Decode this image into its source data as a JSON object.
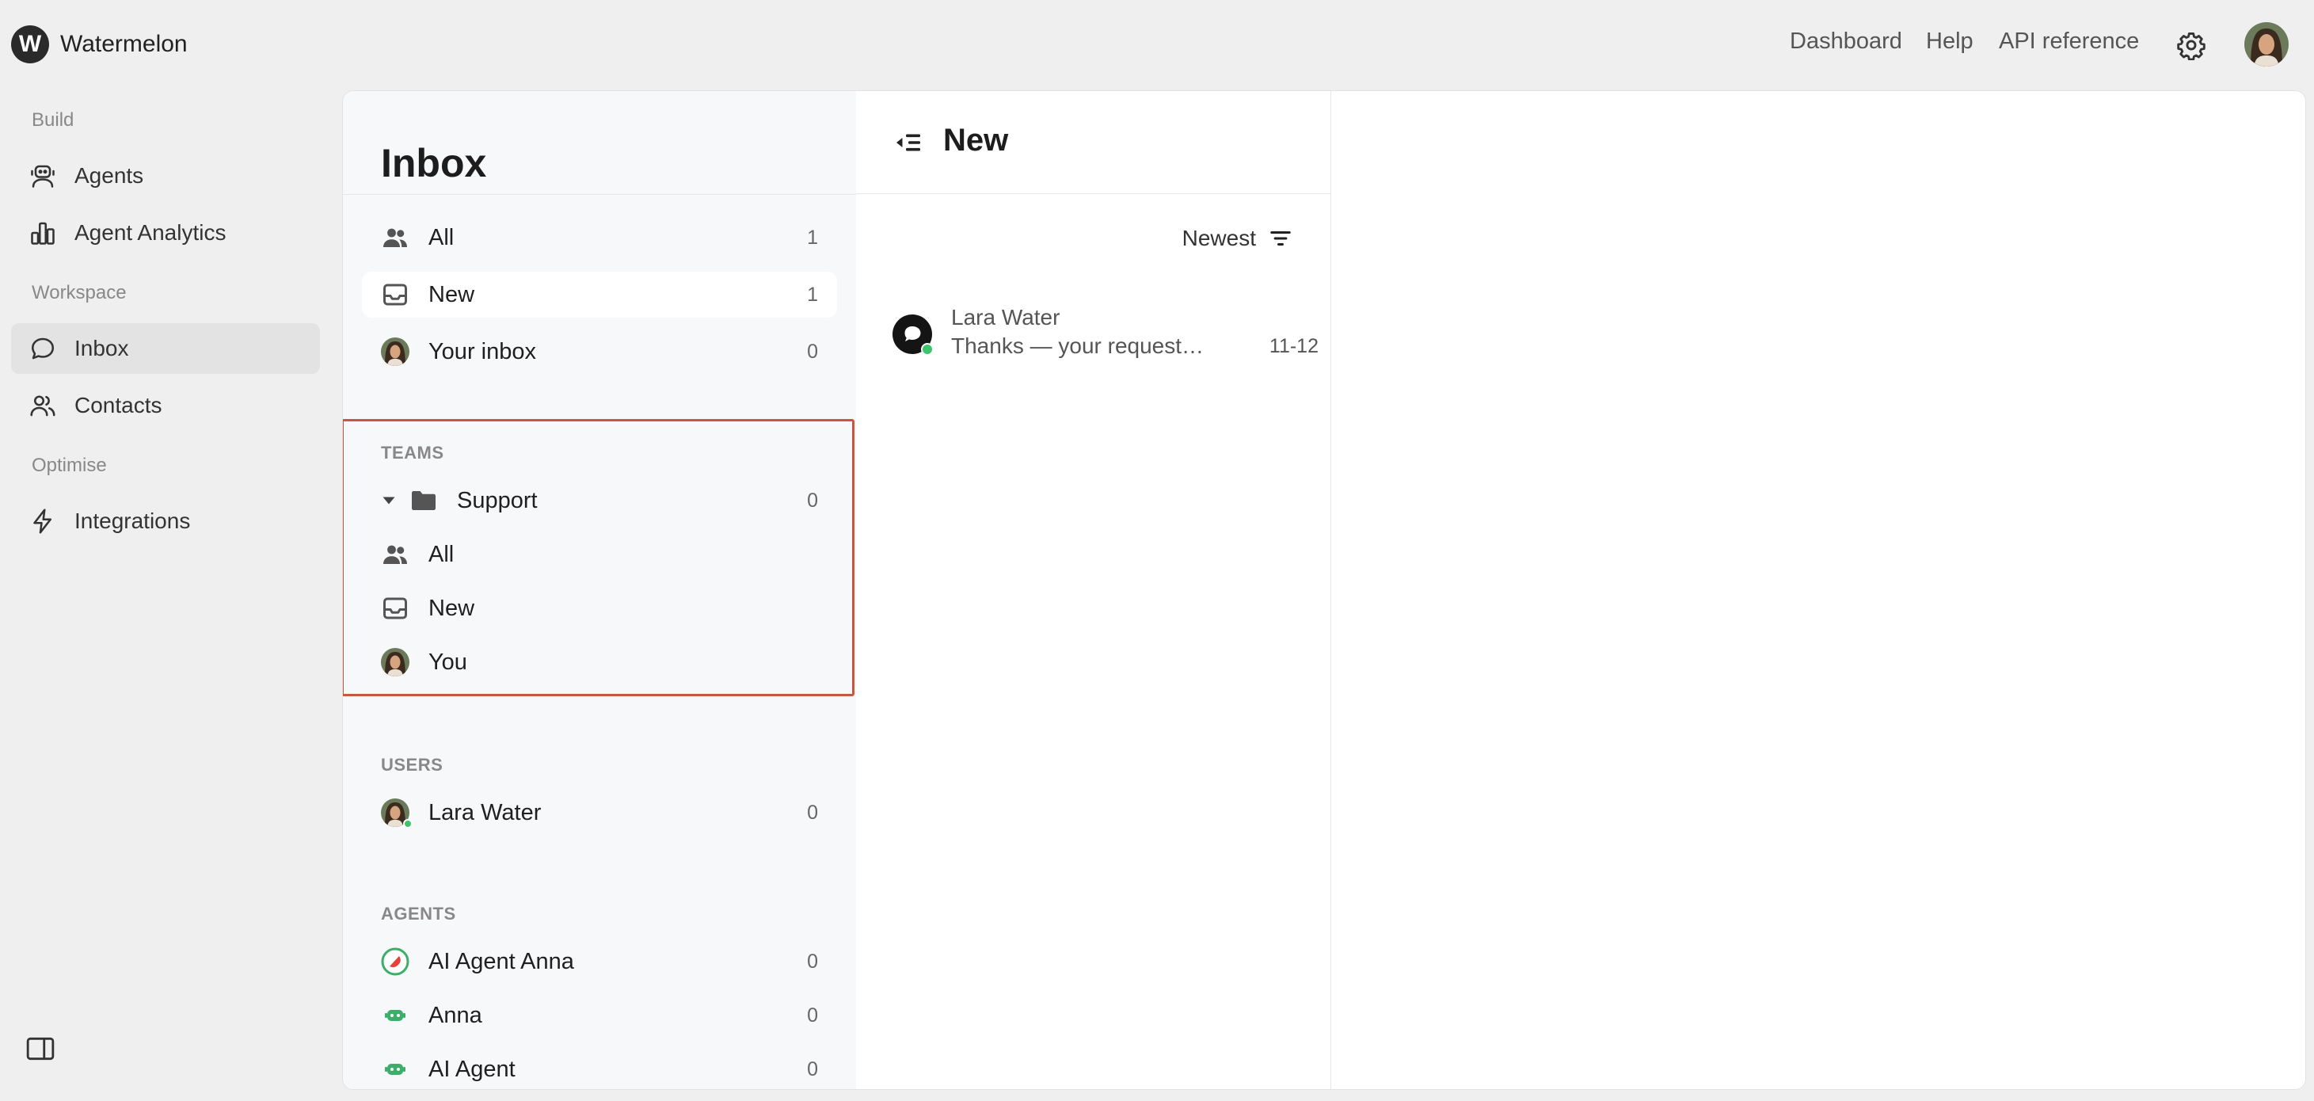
{
  "app": {
    "name": "Watermelon",
    "logo_letter": "W"
  },
  "topnav": {
    "links": [
      "Dashboard",
      "Help",
      "API reference"
    ],
    "settings_icon": "gear-icon"
  },
  "sidebar": {
    "sections": [
      "Build",
      "Workspace",
      "Optimise"
    ],
    "items": [
      {
        "label": "Agents",
        "icon": "robot-icon"
      },
      {
        "label": "Agent Analytics",
        "icon": "bar-chart-icon"
      },
      {
        "label": "Inbox",
        "icon": "chat-bubble-icon",
        "active": true
      },
      {
        "label": "Contacts",
        "icon": "users-icon"
      },
      {
        "label": "Integrations",
        "icon": "lightning-icon"
      }
    ]
  },
  "inbox": {
    "title": "Inbox",
    "views": [
      {
        "label": "All",
        "count": "1"
      },
      {
        "label": "New",
        "count": "1",
        "selected": true
      },
      {
        "label": "Your inbox",
        "count": "0"
      }
    ],
    "teams": {
      "title": "TEAMS",
      "team": {
        "label": "Support",
        "count": "0"
      },
      "sub_items": [
        "All",
        "New",
        "You"
      ]
    },
    "users": {
      "title": "USERS",
      "items": [
        {
          "label": "Lara Water",
          "count": "0"
        }
      ]
    },
    "agents": {
      "title": "AGENTS",
      "items": [
        {
          "label": "AI Agent Anna",
          "count": "0"
        },
        {
          "label": "Anna",
          "count": "0"
        },
        {
          "label": "AI Agent",
          "count": "0"
        }
      ]
    }
  },
  "conversation_list": {
    "title": "New",
    "sort_label": "Newest",
    "conversations": [
      {
        "name": "Lara Water",
        "snippet": "Thanks — your request h...",
        "time": "11-12"
      }
    ]
  },
  "colors": {
    "highlight_border": "#c8553d",
    "online": "#3cc46b",
    "agent_green": "#3cae6a"
  }
}
